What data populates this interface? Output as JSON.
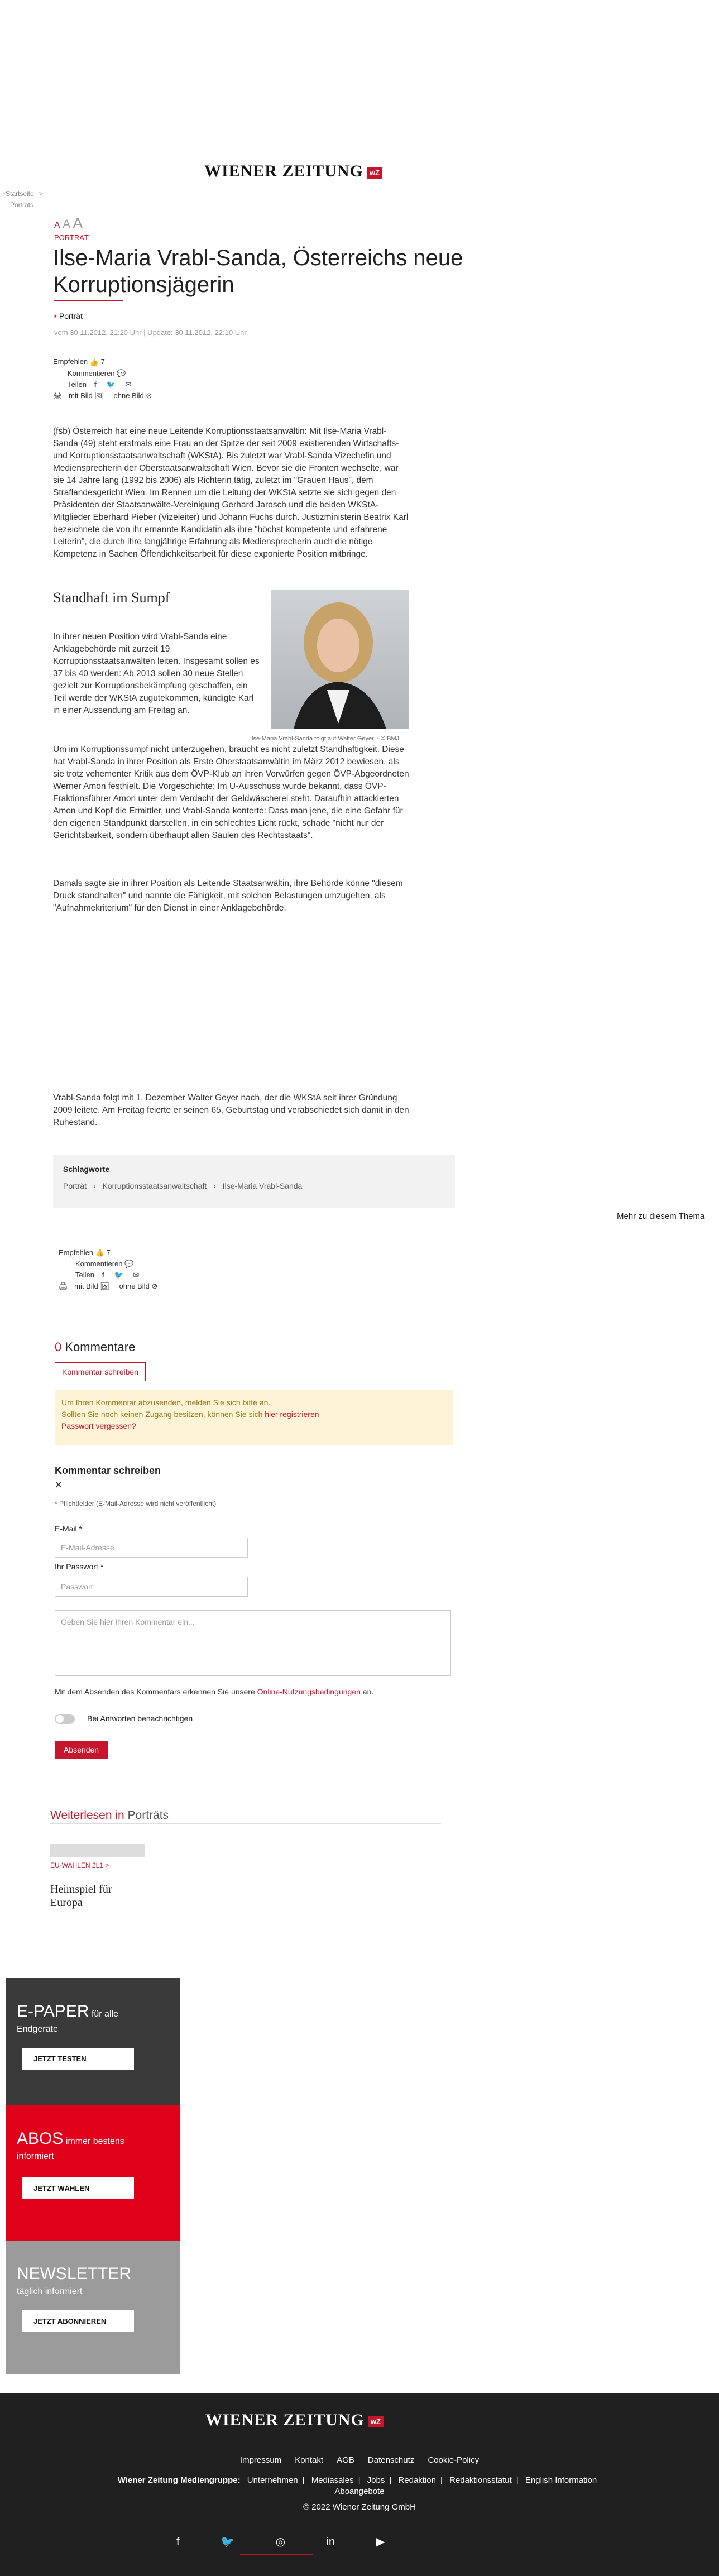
{
  "header": {
    "logo_text": "WIENER ZEITUNG",
    "logo_badge": "wZ"
  },
  "breadcrumb": {
    "home": "Startseite",
    "sep": ">",
    "current": "Porträts"
  },
  "article": {
    "font_sizes": [
      "A",
      "A",
      "A"
    ],
    "kicker": "PORTRÄT",
    "title": "Ilse-Maria Vrabl-Sanda, Österreichs neue Korruptionsjägerin",
    "tag": "Porträt",
    "dates": "vom 30.11.2012, 21:20 Uhr | Update: 30.11.2012, 22:10 Uhr",
    "intro": "(fsb) Österreich hat eine neue Leitende Korruptionsstaatsanwältin: Mit Ilse-Maria Vrabl-Sanda (49) steht erstmals eine Frau an der Spitze der seit 2009 existierenden Wirtschafts- und Korruptionsstaatsanwaltschaft (WKStA). Bis zuletzt war Vrabl-Sanda Vizechefin und Mediensprecherin der Oberstaatsanwaltschaft Wien. Bevor sie die Fronten wechselte, war sie 14 Jahre lang (1992 bis 2006) als Richterin tätig, zuletzt im \"Grauen Haus\", dem Straflandesgericht Wien. Im Rennen um die Leitung der WKStA setzte sie sich gegen den Präsidenten der Staatsanwälte-Vereinigung Gerhard Jarosch und die beiden WKStA-Mitglieder Eberhard Pieber (Vizeleiter) und Johann Fuchs durch. Justizministerin Beatrix Karl bezeichnete die von ihr ernannte Kandidatin als ihre \"höchst kompetente und erfahrene Leiterin\", die durch ihre langjährige Erfahrung als Mediensprecherin auch die nötige Kompetenz in Sachen Öffentlichkeitsarbeit für diese exponierte Position mitbringe.",
    "subhead": "Standhaft im Sumpf",
    "p1": "In ihrer neuen Position wird Vrabl-Sanda eine Anklagebehörde mit zurzeit 19 Korruptionsstaatsanwälten leiten. Insgesamt sollen es 37 bis 40 werden: Ab 2013 sollen 30 neue Stellen gezielt zur Korruptionsbekämpfung geschaffen, ein Teil werde der WKStA zugutekommen, kündigte Karl in einer Aussendung am Freitag an.",
    "p2": "Um im Korruptionssumpf nicht unterzugehen, braucht es nicht zuletzt Standhaftigkeit. Diese hat Vrabl-Sanda in ihrer Position als Erste Oberstaatsanwältin im März 2012 bewiesen, als sie trotz vehementer Kritik aus dem ÖVP-Klub an ihren Vorwürfen gegen ÖVP-Abgeordneten Werner Amon festhielt. Die Vorgeschichte: Im U-Ausschuss wurde bekannt, dass ÖVP-Fraktionsführer Amon unter dem Verdacht der Geldwäscherei steht. Daraufhin attackierten Amon und Kopf die Ermittler, und Vrabl-Sanda konterte: Dass man jene, die eine Gefahr für den eigenen Standpunkt darstellen, in ein schlechtes Licht rückt, schade \"nicht nur der Gerichtsbarkeit, sondern überhaupt allen Säulen des Rechtsstaats\".",
    "p3": "Damals sagte sie in ihrer Position als Leitende Staatsanwältin, ihre Behörde könne \"diesem Druck standhalten\" und nannte die Fähigkeit, mit solchen Belastungen umzugehen, als \"Aufnahmekriterium\" für den Dienst in einer Anklagebehörde.",
    "p4": "Vrabl-Sanda folgt mit 1. Dezember Walter Geyer nach, der die WKStA seit ihrer Gründung 2009 leitete. Am Freitag feierte er seinen 65. Geburtstag und verabschiedet sich damit in den Ruhestand.",
    "caption": "Ilse-Maria Vrabl-Sanda folgt auf Walter Geyer. - © BMJ"
  },
  "share": {
    "empfehlen": "Empfehlen",
    "likes": "7",
    "kommentieren": "Kommentieren",
    "teilen": "Teilen",
    "mit_bild": "mit Bild",
    "ohne_bild": "ohne Bild"
  },
  "keywords": {
    "label": "Schlagworte",
    "items": [
      "Porträt",
      "Korruptionsstaatsanwaltschaft",
      "Ilse-Maria Vrabl-Sanda"
    ]
  },
  "more_topic": "Mehr zu diesem Thema",
  "comments": {
    "count": "0",
    "label": "Kommentare",
    "write_btn": "Kommentar schreiben",
    "notice1": "Um Ihren Kommentar abzusenden, melden Sie sich bitte an.",
    "notice2a": "Sollten Sie noch keinen Zugang besitzen, können Sie sich ",
    "notice2b": "hier registrieren",
    "notice3": "Passwort vergessen?",
    "form_title": "Kommentar schreiben",
    "close": "✕",
    "required": "* Pflichtfelder (E-Mail-Adresse wird nicht veröffentlicht)",
    "email_label": "E-Mail *",
    "email_ph": "E-Mail-Adresse",
    "pw_label": "Ihr Passwort *",
    "pw_ph": "Passwort",
    "text_ph": "Geben Sie hier Ihren Kommentar ein...",
    "terms_a": "Mit dem Absenden des Kommentars erkennen Sie unsere ",
    "terms_b": "Online-Nutzungsbedingungen",
    "terms_c": " an.",
    "notify": "Bei Antworten benachrichtigen",
    "submit": "Absenden"
  },
  "read_more": {
    "a": "Weiterlesen in ",
    "b": "Porträts",
    "teaser_kicker": "EU-WAHLEN 2L1 >",
    "teaser_title": "Heimspiel für Europa"
  },
  "side": {
    "epaper": {
      "title": "E-PAPER",
      "suffix": "für alle",
      "sub": "Endgeräte",
      "btn": "JETZT TESTEN"
    },
    "abos": {
      "title": "ABOS",
      "suffix": "immer bestens",
      "sub": "informiert",
      "btn": "JETZT WÄHLEN"
    },
    "news": {
      "title": "NEWSLETTER",
      "sub": "täglich informiert",
      "btn": "JETZT ABONNIEREN"
    }
  },
  "footer": {
    "links": [
      "Impressum",
      "Kontakt",
      "AGB",
      "Datenschutz",
      "Cookie-Policy"
    ],
    "group_label": "Wiener Zeitung Mediengruppe:",
    "group_links": [
      "Unternehmen",
      "Mediasales",
      "Jobs",
      "Redaktion",
      "Redaktionsstatut",
      "English Information",
      "Aboangebote"
    ],
    "copyright": "© 2022 Wiener Zeitung GmbH"
  },
  "colors": {
    "accent": "#c5162e",
    "footer_bg": "#202020"
  }
}
